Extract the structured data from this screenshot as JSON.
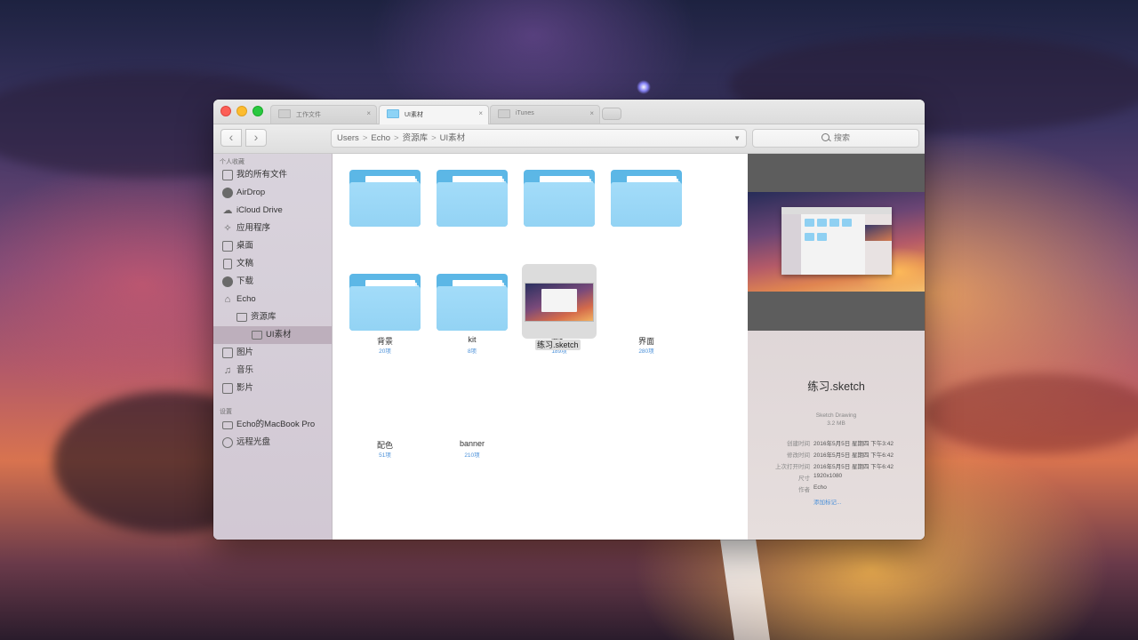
{
  "window": {
    "tabs": [
      {
        "label": "工作文件",
        "close": "×"
      },
      {
        "label": "UI素材",
        "close": "×"
      },
      {
        "label": "iTunes",
        "close": "×"
      }
    ]
  },
  "toolbar": {
    "back_glyph": "‹",
    "forward_glyph": "›",
    "path": [
      "Users",
      "Echo",
      "资源库",
      "UI素材"
    ],
    "path_separator": ">",
    "search_placeholder": "搜索"
  },
  "sidebar": {
    "favorites_header": "个人收藏",
    "favorites": [
      {
        "label": "我的所有文件",
        "icon": "all-files-icon"
      },
      {
        "label": "AirDrop",
        "icon": "airdrop-icon"
      },
      {
        "label": "iCloud Drive",
        "icon": "cloud-icon"
      },
      {
        "label": "应用程序",
        "icon": "applications-icon"
      },
      {
        "label": "桌面",
        "icon": "desktop-icon"
      },
      {
        "label": "文稿",
        "icon": "document-icon"
      },
      {
        "label": "下载",
        "icon": "download-icon"
      },
      {
        "label": "Echo",
        "icon": "home-icon"
      },
      {
        "label": "资源库",
        "icon": "folder-icon"
      },
      {
        "label": "UI素材",
        "icon": "folder-icon",
        "selected": true
      },
      {
        "label": "图片",
        "icon": "camera-icon"
      },
      {
        "label": "音乐",
        "icon": "music-icon"
      },
      {
        "label": "影片",
        "icon": "film-icon"
      }
    ],
    "devices_header": "设置",
    "devices": [
      {
        "label": "Echo的MacBook Pro",
        "icon": "laptop-icon"
      },
      {
        "label": "远程光盘",
        "icon": "disc-icon"
      }
    ]
  },
  "files": [
    {
      "name": "背景",
      "count": "20项",
      "type": "folder"
    },
    {
      "name": "kit",
      "count": "8项",
      "type": "folder"
    },
    {
      "name": "图标",
      "count": "189项",
      "type": "folder"
    },
    {
      "name": "界面",
      "count": "280项",
      "type": "folder"
    },
    {
      "name": "配色",
      "count": "51项",
      "type": "folder"
    },
    {
      "name": "banner",
      "count": "210项",
      "type": "folder"
    },
    {
      "name": "练习.sketch",
      "type": "sketch",
      "selected": true
    }
  ],
  "preview": {
    "title": "练习.sketch",
    "kind": "Sketch Drawing",
    "size": "3.2 MB",
    "meta": [
      {
        "key": "创建时间",
        "value": "2016年5月5日 星期四 下午3:42"
      },
      {
        "key": "修改时间",
        "value": "2016年5月5日 星期四 下午6:42"
      },
      {
        "key": "上次打开时间",
        "value": "2016年5月5日 星期四 下午6:42"
      },
      {
        "key": "尺寸",
        "value": "1920x1080"
      },
      {
        "key": "作者",
        "value": "Echo"
      }
    ],
    "add_tags": "添加标记..."
  },
  "colors": {
    "folder_front": "#a3dcf9",
    "folder_back": "#5cb7e6",
    "accent_link": "#4a90d9",
    "sidebar_selected": "#aa96a5"
  }
}
